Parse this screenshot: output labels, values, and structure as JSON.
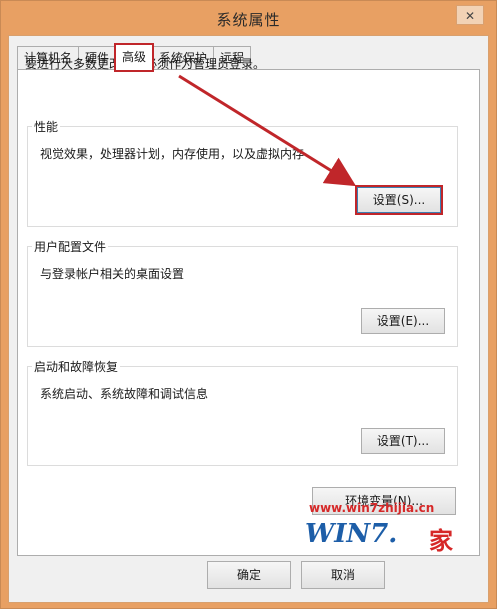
{
  "window": {
    "title": "系统属性",
    "close_label": "✕"
  },
  "tabs": [
    {
      "label": "计算机名"
    },
    {
      "label": "硬件"
    },
    {
      "label": "高级"
    },
    {
      "label": "系统保护"
    },
    {
      "label": "远程"
    }
  ],
  "notice": "要进行大多数更改，你必须作为管理员登录。",
  "performance": {
    "title": "性能",
    "desc": "视觉效果，处理器计划，内存使用，以及虚拟内存",
    "button": "设置(S)..."
  },
  "profiles": {
    "title": "用户配置文件",
    "desc": "与登录帐户相关的桌面设置",
    "button": "设置(E)..."
  },
  "startup": {
    "title": "启动和故障恢复",
    "desc": "系统启动、系统故障和调试信息",
    "button": "设置(T)..."
  },
  "env_button": "环境变量(N)...",
  "footer": {
    "ok": "确定",
    "cancel": "取消"
  },
  "watermark": {
    "url": "www.win7zhijia.cn",
    "logo": "WIN7.",
    "suffix": "家"
  },
  "colors": {
    "titlebar": "#e8a063",
    "highlight": "#c0262a",
    "watermark_blue": "#1d5ea8"
  }
}
